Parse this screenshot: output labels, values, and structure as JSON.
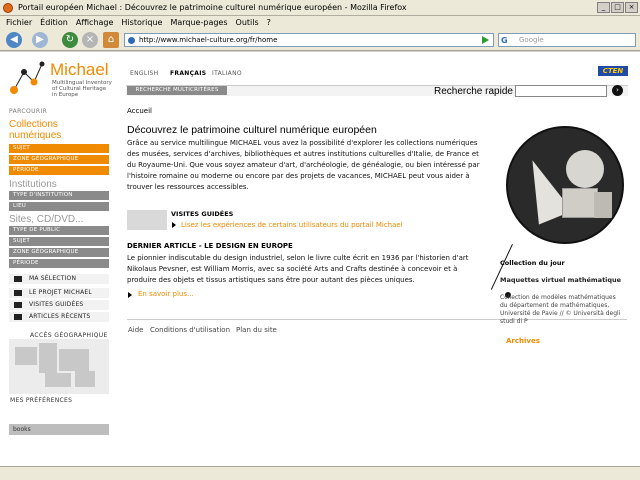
{
  "window": {
    "title": "Portail européen Michael : Découvrez le patrimoine culturel numérique européen - Mozilla Firefox",
    "menu": [
      "Fichier",
      "Édition",
      "Affichage",
      "Historique",
      "Marque-pages",
      "Outils",
      "?"
    ],
    "url": "http://www.michael-culture.org/fr/home",
    "search_placeholder": "Google"
  },
  "header": {
    "logo_name": "Michael",
    "logo_sub": "Multilingual Inventory of Cultural Heritage in Europe",
    "languages": [
      "ENGLISH",
      "FRANÇAIS",
      "ITALIANO"
    ],
    "active_language": "FRANÇAIS",
    "partner": "CTEN",
    "advanced_search": "RECHERCHE MULTICRITÈRES",
    "quick_search_label": "Recherche rapide"
  },
  "sidebar": {
    "browse": "PARCOURIR",
    "collections_title": "Collections numériques",
    "collections_items": [
      "SUJET",
      "ZONE GÉOGRAPHIQUE",
      "PÉRIODE"
    ],
    "institutions_title": "Institutions",
    "institutions_items": [
      "TYPE D'INSTITUTION",
      "LIEU"
    ],
    "sites_title": "Sites, CD/DVD...",
    "sites_items": [
      "TYPE DE PUBLIC",
      "SUJET",
      "ZONE GÉOGRAPHIQUE",
      "PÉRIODE"
    ],
    "links": [
      "MA SÉLECTION",
      "LE PROJET MICHAEL",
      "VISITES GUIDÉES",
      "ARTICLES RÉCENTS"
    ],
    "geo_access": "ACCÈS GÉOGRAPHIQUE",
    "preferences": "MES PRÉFÉRENCES",
    "books": "books"
  },
  "main": {
    "breadcrumb": "Accueil",
    "heading": "Découvrez le patrimoine culturel numérique européen",
    "intro": "Grâce au service multilingue MICHAEL vous avez la possibilité d'explorer les collections numériques des musées, services d'archives, bibliothèques et autres institutions culturelles d'Italie, de France et du Royaume-Uni. Que vous soyez amateur d'art, d'archéologie, de généalogie, ou bien intéressé par l'histoire romaine ou moderne ou encore par des projets de vacances, MICHAEL peut vous aider à trouver les ressources accessibles.",
    "guided_title": "VISITES GUIDÉES",
    "guided_link": "Lisez les expériences de certains utilisateurs du portail Michael",
    "article_title": "DERNIER ARTICLE - LE DESIGN EN EUROPE",
    "article_text": "Le pionnier indiscutable du design industriel, selon le livre culte écrit en 1936 par l'historien d'art Nikolaus Pevsner, est William Morris, avec sa société Arts and Crafts destinée à concevoir et à produire des objets et tissus artistiques sans être pour autant des pièces uniques.",
    "more": "En savoir plus...",
    "footer": [
      "Aide",
      "Conditions d'utilisation",
      "Plan du site"
    ]
  },
  "collection_day": {
    "label": "Collection du jour",
    "title": "Maquettes virtuel mathématique",
    "description": "Collection de modèles mathématiques du département de mathématiques, Université de Pavie // © Università degli studi di P",
    "archives": "Archives"
  }
}
